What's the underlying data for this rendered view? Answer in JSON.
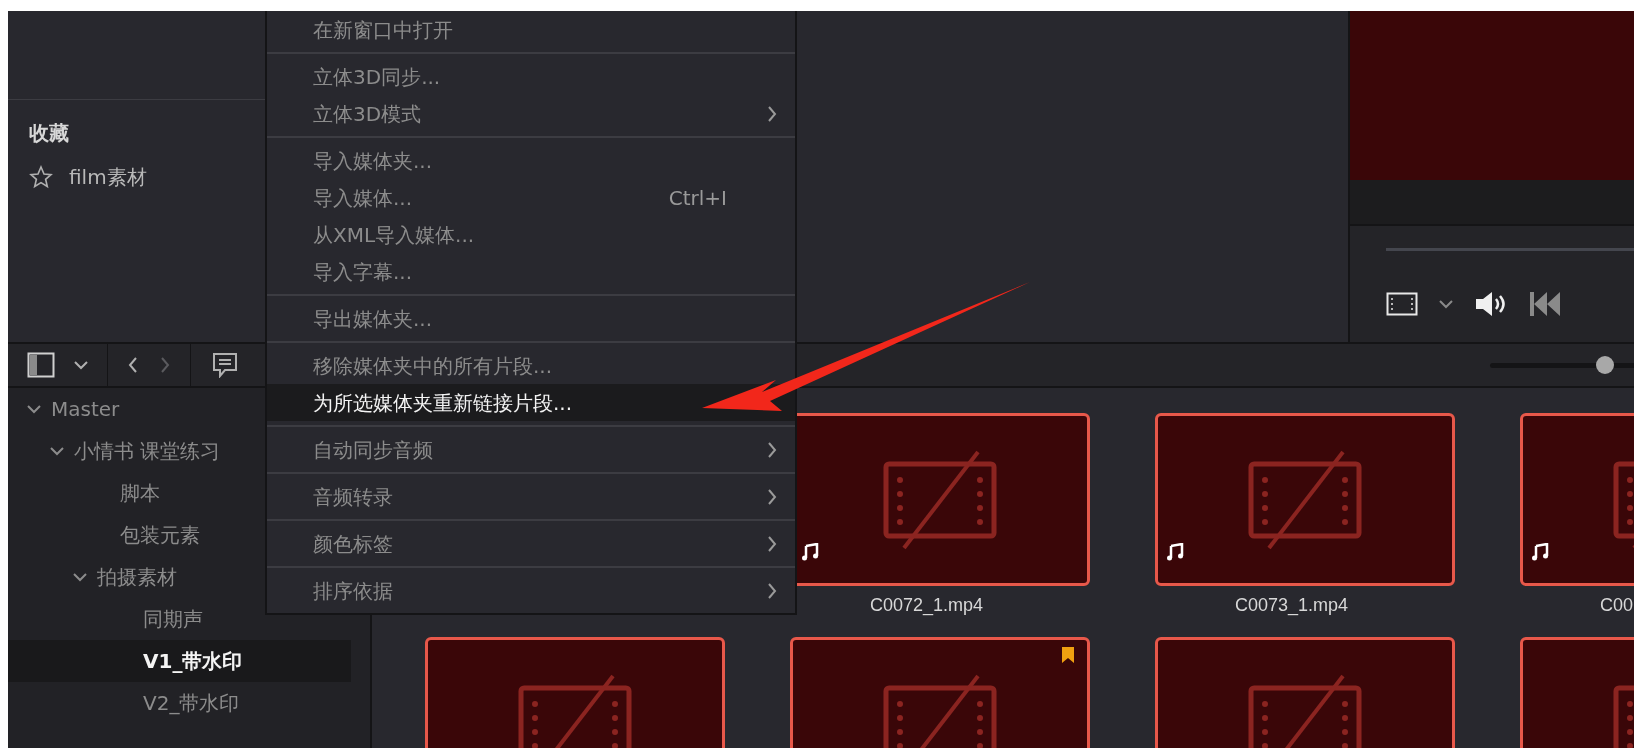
{
  "favorites": {
    "title": "收藏",
    "items": [
      {
        "label": "film素材"
      }
    ]
  },
  "context_menu": [
    {
      "kind": "item",
      "label": "在新窗口中打开",
      "highlighted": false,
      "submenu": false
    },
    {
      "kind": "separator"
    },
    {
      "kind": "item",
      "label": "立体3D同步...",
      "highlighted": false,
      "submenu": false
    },
    {
      "kind": "item",
      "label": "立体3D模式",
      "highlighted": false,
      "submenu": true
    },
    {
      "kind": "separator"
    },
    {
      "kind": "item",
      "label": "导入媒体夹...",
      "highlighted": false,
      "submenu": false
    },
    {
      "kind": "item",
      "label": "导入媒体...",
      "shortcut": "Ctrl+I",
      "highlighted": false,
      "submenu": false
    },
    {
      "kind": "item",
      "label": "从XML导入媒体...",
      "highlighted": false,
      "submenu": false
    },
    {
      "kind": "item",
      "label": "导入字幕...",
      "highlighted": false,
      "submenu": false
    },
    {
      "kind": "separator"
    },
    {
      "kind": "item",
      "label": "导出媒体夹...",
      "highlighted": false,
      "submenu": false
    },
    {
      "kind": "separator"
    },
    {
      "kind": "item",
      "label": "移除媒体夹中的所有片段...",
      "highlighted": false,
      "submenu": false
    },
    {
      "kind": "item",
      "label": "为所选媒体夹重新链接片段...",
      "highlighted": true,
      "submenu": false
    },
    {
      "kind": "separator"
    },
    {
      "kind": "item",
      "label": "自动同步音频",
      "highlighted": false,
      "submenu": true
    },
    {
      "kind": "separator"
    },
    {
      "kind": "item",
      "label": "音频转录",
      "highlighted": false,
      "submenu": true
    },
    {
      "kind": "separator"
    },
    {
      "kind": "item",
      "label": "颜色标签",
      "highlighted": false,
      "submenu": true
    },
    {
      "kind": "separator"
    },
    {
      "kind": "item",
      "label": "排序依据",
      "highlighted": false,
      "submenu": true
    }
  ],
  "bin_tree": [
    {
      "label": "Master",
      "expanded": true,
      "selected": false,
      "children": [
        {
          "label": "小情书 课堂练习",
          "expanded": true,
          "selected": false,
          "children": [
            {
              "label": "脚本",
              "selected": false
            },
            {
              "label": "包装元素",
              "selected": false
            },
            {
              "label": "拍摄素材",
              "expanded": true,
              "selected": false,
              "children": [
                {
                  "label": "同期声",
                  "selected": false
                },
                {
                  "label": "V1_带水印",
                  "selected": true
                },
                {
                  "label": "V2_带水印",
                  "selected": false
                }
              ]
            }
          ]
        }
      ]
    }
  ],
  "zoom_slider": {
    "level": 0.8
  },
  "clip_rows": [
    [
      {
        "label": "C0072_1.mp4",
        "audio": true,
        "flagged": false
      },
      {
        "label": "C0073_1.mp4",
        "audio": true,
        "flagged": false
      },
      {
        "label": "C00",
        "audio": true,
        "flagged": false
      }
    ],
    [
      {
        "flagged": false
      },
      {
        "flagged": true
      },
      {
        "flagged": false
      },
      {}
    ]
  ]
}
